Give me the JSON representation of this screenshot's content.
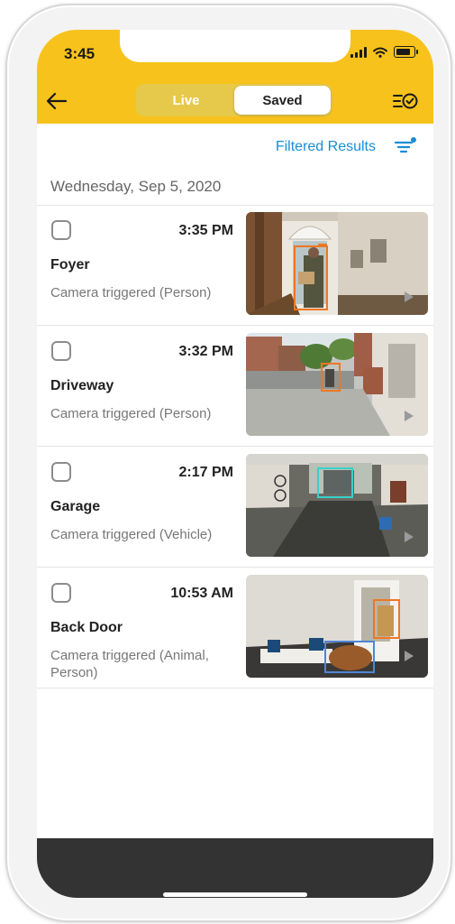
{
  "status": {
    "time": "3:45"
  },
  "header": {
    "back_icon": "arrow-left-icon",
    "tabs": [
      {
        "label": "Live",
        "selected": false
      },
      {
        "label": "Saved",
        "selected": true
      }
    ],
    "events_icon": "list-check-icon",
    "accent_color": "#f7c21b"
  },
  "filter": {
    "label": "Filtered Results",
    "icon": "filter-icon",
    "color": "#1a8dd6"
  },
  "date_header": "Wednesday, Sep 5, 2020",
  "events": [
    {
      "time": "3:35 PM",
      "title": "Foyer",
      "description": "Camera triggered (Person)",
      "thumbnail": "foyer-snapshot"
    },
    {
      "time": "3:32 PM",
      "title": "Driveway",
      "description": "Camera triggered (Person)",
      "thumbnail": "driveway-snapshot"
    },
    {
      "time": "2:17 PM",
      "title": "Garage",
      "description": "Camera triggered (Vehicle)",
      "thumbnail": "garage-snapshot"
    },
    {
      "time": "10:53 AM",
      "title": "Back Door",
      "description": "Camera triggered (Animal, Person)",
      "thumbnail": "back-door-snapshot"
    }
  ]
}
